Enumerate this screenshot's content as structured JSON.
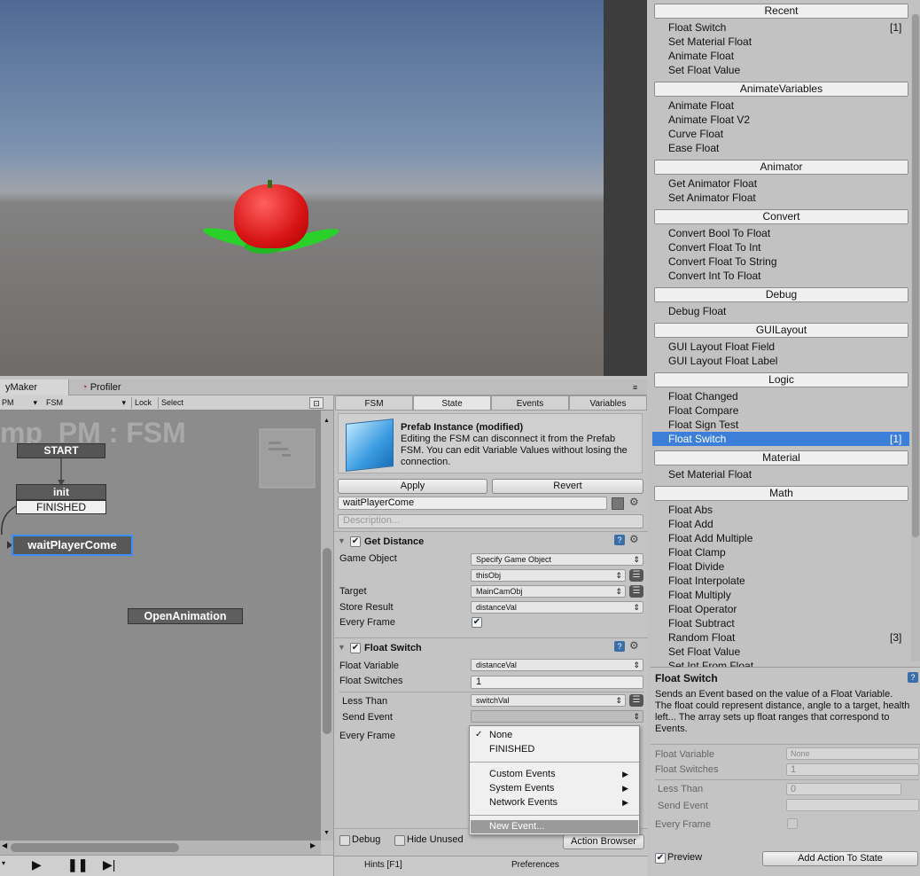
{
  "scene": {
    "description_free": true
  },
  "tabs": {
    "playmaker": "yMaker",
    "profiler": "Profiler"
  },
  "toolbar": {
    "owner": "PM",
    "fsm": "FSM",
    "lock": "Lock",
    "select": "Select"
  },
  "graph": {
    "title": "mp_PM : FSM",
    "start": "START",
    "init": "init",
    "finished": "FINISHED",
    "wait": "waitPlayerCome",
    "open": "OpenAnimation"
  },
  "inspector": {
    "tabs": [
      "FSM",
      "State",
      "Events",
      "Variables"
    ],
    "prefab_title": "Prefab Instance (modified)",
    "prefab_text": "Editing the FSM can disconnect it from the Prefab FSM. You can edit Variable Values without losing the connection.",
    "apply": "Apply",
    "revert": "Revert",
    "state_name": "waitPlayerCome",
    "description_placeholder": "Description...",
    "get_distance": {
      "title": "Get Distance",
      "game_object_label": "Game Object",
      "game_object_value": "Specify Game Object",
      "this_obj": "thisObj",
      "target_label": "Target",
      "target_value": "MainCamObj",
      "store_label": "Store Result",
      "store_value": "distanceVal",
      "every_frame": "Every Frame"
    },
    "float_switch": {
      "title": "Float Switch",
      "float_var_label": "Float Variable",
      "float_var_value": "distanceVal",
      "switches_label": "Float Switches",
      "switches_value": "1",
      "less_than_label": "Less Than",
      "less_than_value": "switchVal",
      "send_event_label": "Send Event",
      "every_frame": "Every Frame"
    },
    "popup": {
      "none": "None",
      "finished": "FINISHED",
      "custom": "Custom Events",
      "system": "System Events",
      "network": "Network Events",
      "new": "New Event..."
    },
    "debug": "Debug",
    "hide_unused": "Hide Unused",
    "action_browser": "Action Browser",
    "hints": "Hints [F1]",
    "preferences": "Preferences"
  },
  "browser": {
    "sections": [
      {
        "header": "Recent",
        "items": [
          {
            "label": "Float Switch",
            "count": "[1]"
          },
          {
            "label": "Set Material Float"
          },
          {
            "label": "Animate Float"
          },
          {
            "label": "Set Float Value"
          }
        ]
      },
      {
        "header": "AnimateVariables",
        "items": [
          {
            "label": "Animate Float"
          },
          {
            "label": "Animate Float V2"
          },
          {
            "label": "Curve Float"
          },
          {
            "label": "Ease Float"
          }
        ]
      },
      {
        "header": "Animator",
        "items": [
          {
            "label": "Get Animator Float"
          },
          {
            "label": "Set Animator Float"
          }
        ]
      },
      {
        "header": "Convert",
        "items": [
          {
            "label": "Convert Bool To Float"
          },
          {
            "label": "Convert Float To Int"
          },
          {
            "label": "Convert Float To String"
          },
          {
            "label": "Convert Int To Float"
          }
        ]
      },
      {
        "header": "Debug",
        "items": [
          {
            "label": "Debug Float"
          }
        ]
      },
      {
        "header": "GUILayout",
        "items": [
          {
            "label": "GUI  Layout Float Field"
          },
          {
            "label": "GUI  Layout Float Label"
          }
        ]
      },
      {
        "header": "Logic",
        "items": [
          {
            "label": "Float Changed"
          },
          {
            "label": "Float Compare"
          },
          {
            "label": "Float Sign Test"
          },
          {
            "label": "Float Switch",
            "count": "[1]",
            "selected": true
          }
        ]
      },
      {
        "header": "Material",
        "items": [
          {
            "label": "Set Material Float"
          }
        ]
      },
      {
        "header": "Math",
        "items": [
          {
            "label": "Float Abs"
          },
          {
            "label": "Float Add"
          },
          {
            "label": "Float Add Multiple"
          },
          {
            "label": "Float Clamp"
          },
          {
            "label": "Float Divide"
          },
          {
            "label": "Float Interpolate"
          },
          {
            "label": "Float Multiply"
          },
          {
            "label": "Float Operator"
          },
          {
            "label": "Float Subtract"
          },
          {
            "label": "Random Float",
            "count": "[3]"
          },
          {
            "label": "Set Float Value"
          },
          {
            "label": "Set Int From Float"
          }
        ]
      }
    ],
    "selected_color": "#3c7fd8"
  },
  "detail": {
    "title": "Float Switch",
    "text": "Sends an Event based on the value of a Float Variable. The float could represent distance, angle to a target, health left... The array sets up float ranges that correspond to Events.",
    "float_var_label": "Float Variable",
    "float_var_value": "None",
    "switches_label": "Float Switches",
    "switches_value": "1",
    "less_than_label": "Less Than",
    "less_than_value": "0",
    "send_event_label": "Send Event",
    "every_frame_label": "Every Frame",
    "preview": "Preview",
    "add_action": "Add Action To State"
  }
}
